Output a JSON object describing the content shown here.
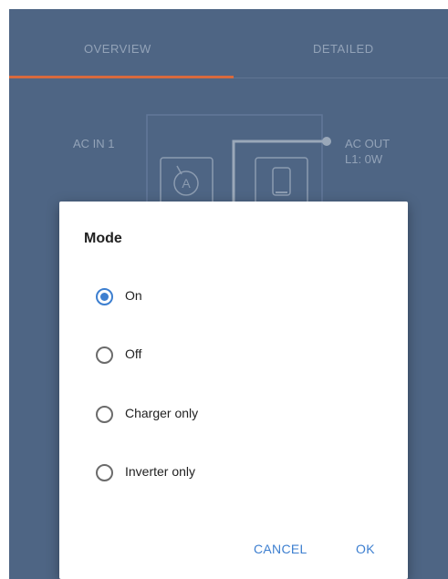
{
  "tabs": [
    {
      "label": "OVERVIEW"
    },
    {
      "label": "DETAILED"
    }
  ],
  "overview": {
    "ac_in_label": "AC IN 1",
    "ac_out_label": "AC OUT",
    "ac_out_value": "L1: 0W"
  },
  "colors": {
    "accent": "#3d7fd0",
    "tab_indicator": "#d86a3e",
    "background": "#4e6584"
  },
  "dialog": {
    "title": "Mode",
    "options": [
      {
        "label": "On",
        "selected": true
      },
      {
        "label": "Off",
        "selected": false
      },
      {
        "label": "Charger only",
        "selected": false
      },
      {
        "label": "Inverter only",
        "selected": false
      }
    ],
    "cancel_label": "CANCEL",
    "ok_label": "OK"
  }
}
